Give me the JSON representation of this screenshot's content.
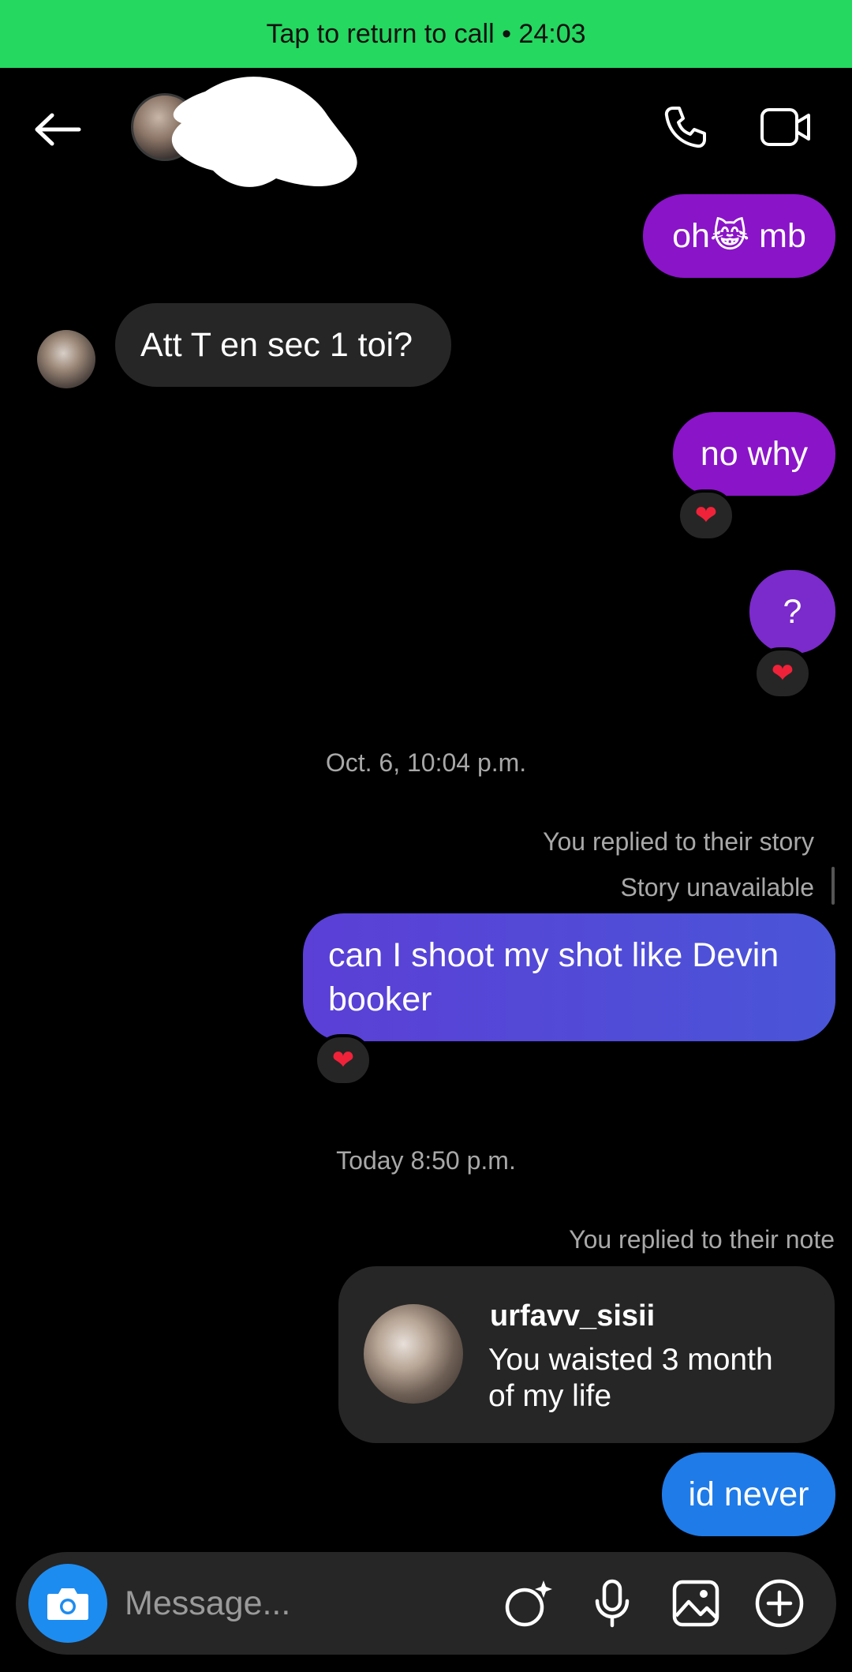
{
  "call_banner": {
    "text": "Tap to return to call • 24:03"
  },
  "header": {
    "back_icon": "arrow-left-icon",
    "call_icon": "phone-icon",
    "video_icon": "video-camera-icon"
  },
  "messages": {
    "m1": {
      "text": "oh😹 mb"
    },
    "m2": {
      "text": "Att T en sec 1 toi?"
    },
    "m3": {
      "text": "no why",
      "reaction": "❤"
    },
    "m4": {
      "text": "?",
      "reaction": "❤"
    },
    "ts1": "Oct. 6, 10:04 p.m.",
    "story_meta": {
      "line1": "You replied to their story",
      "line2": "Story unavailable"
    },
    "m5": {
      "text": "can I shoot my shot like Devin booker",
      "reaction": "❤"
    },
    "ts2": "Today 8:50 p.m.",
    "note_meta": "You replied to their note",
    "note": {
      "username": "urfavv_sisii",
      "text": "You waisted 3 month of my life"
    },
    "m6": {
      "text": "id never"
    }
  },
  "composer": {
    "placeholder": "Message...",
    "icons": [
      "camera-icon",
      "sticker-sparkle-icon",
      "microphone-icon",
      "gallery-icon",
      "plus-circle-icon"
    ]
  },
  "colors": {
    "banner": "#25d860",
    "bubble_purple": "#8a14c8",
    "bubble_indigo": "#4a55d8",
    "bubble_blue": "#1f7be8",
    "bubble_gray": "#262626"
  }
}
